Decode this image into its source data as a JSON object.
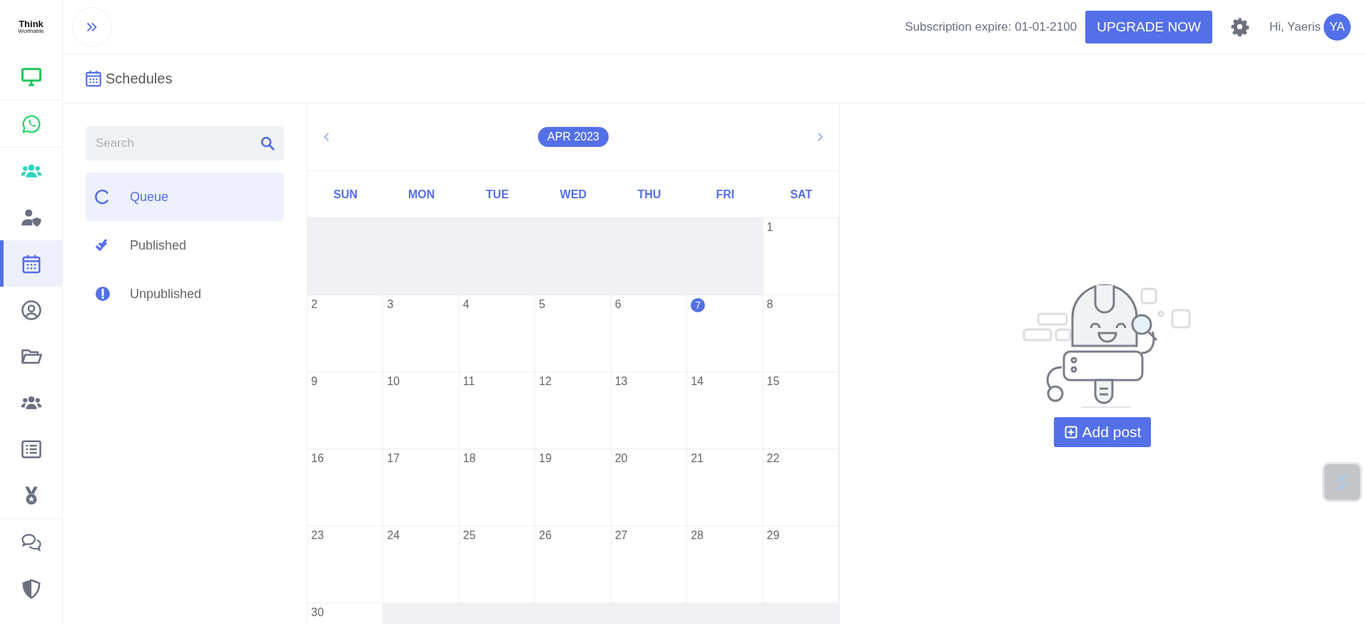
{
  "sidebar": {
    "logo": {
      "line_1": "Think",
      "line_2": "Worthable"
    },
    "groups": [
      [
        {
          "kind": "monitor",
          "selected": false,
          "color": "#22c55e"
        }
      ],
      [
        {
          "kind": "whatsapp",
          "selected": false,
          "color": "#25d366"
        }
      ],
      [
        {
          "kind": "users",
          "selected": false,
          "color": "#2dd4bf"
        },
        {
          "kind": "user-shield",
          "selected": false,
          "color": "#6b6f80"
        },
        {
          "kind": "calendar",
          "selected": true,
          "color": "#5470e8"
        },
        {
          "kind": "user-circle",
          "selected": false,
          "color": "#6b6f80"
        },
        {
          "kind": "folder",
          "selected": false,
          "color": "#6b6f80"
        },
        {
          "kind": "users",
          "selected": false,
          "color": "#6b6f80"
        },
        {
          "kind": "list",
          "selected": false,
          "color": "#6b6f80"
        },
        {
          "kind": "medal",
          "selected": false,
          "color": "#6b6f80"
        }
      ],
      [
        {
          "kind": "chat",
          "selected": false,
          "color": "#6b6f80"
        },
        {
          "kind": "shield",
          "selected": false,
          "color": "#6b6f80"
        }
      ]
    ]
  },
  "topbar": {
    "subscription": "Subscription expire: 01-01-2100",
    "upgrade_button": "UPGRADE NOW",
    "greeting": "Hi, Yaeris",
    "avatar": "YA"
  },
  "page_title": "Schedules",
  "filters": {
    "search": {
      "placeholder": "Search"
    },
    "items": [
      {
        "kind": "queue",
        "label": "Queue",
        "selected": true
      },
      {
        "kind": "published",
        "label": "Published",
        "selected": false
      },
      {
        "kind": "unpublished",
        "label": "Unpublished",
        "selected": false
      }
    ]
  },
  "calendar": {
    "month": "APR 2023",
    "weekdays": [
      "SUN",
      "MON",
      "TUE",
      "WED",
      "THU",
      "FRI",
      "SAT"
    ],
    "weeks": [
      [
        {
          "kind": "blank"
        },
        {
          "kind": "blank"
        },
        {
          "kind": "blank"
        },
        {
          "kind": "blank"
        },
        {
          "kind": "blank"
        },
        {
          "kind": "blank"
        },
        {
          "kind": "day",
          "day": "1",
          "today": false
        }
      ],
      [
        {
          "kind": "day",
          "day": "2",
          "today": false
        },
        {
          "kind": "day",
          "day": "3",
          "today": false
        },
        {
          "kind": "day",
          "day": "4",
          "today": false
        },
        {
          "kind": "day",
          "day": "5",
          "today": false
        },
        {
          "kind": "day",
          "day": "6",
          "today": false
        },
        {
          "kind": "day",
          "day": "7",
          "today": true
        },
        {
          "kind": "day",
          "day": "8",
          "today": false
        }
      ],
      [
        {
          "kind": "day",
          "day": "9",
          "today": false
        },
        {
          "kind": "day",
          "day": "10",
          "today": false
        },
        {
          "kind": "day",
          "day": "11",
          "today": false
        },
        {
          "kind": "day",
          "day": "12",
          "today": false
        },
        {
          "kind": "day",
          "day": "13",
          "today": false
        },
        {
          "kind": "day",
          "day": "14",
          "today": false
        },
        {
          "kind": "day",
          "day": "15",
          "today": false
        }
      ],
      [
        {
          "kind": "day",
          "day": "16",
          "today": false
        },
        {
          "kind": "day",
          "day": "17",
          "today": false
        },
        {
          "kind": "day",
          "day": "18",
          "today": false
        },
        {
          "kind": "day",
          "day": "19",
          "today": false
        },
        {
          "kind": "day",
          "day": "20",
          "today": false
        },
        {
          "kind": "day",
          "day": "21",
          "today": false
        },
        {
          "kind": "day",
          "day": "22",
          "today": false
        }
      ],
      [
        {
          "kind": "day",
          "day": "23",
          "today": false
        },
        {
          "kind": "day",
          "day": "24",
          "today": false
        },
        {
          "kind": "day",
          "day": "25",
          "today": false
        },
        {
          "kind": "day",
          "day": "26",
          "today": false
        },
        {
          "kind": "day",
          "day": "27",
          "today": false
        },
        {
          "kind": "day",
          "day": "28",
          "today": false
        },
        {
          "kind": "day",
          "day": "29",
          "today": false
        }
      ],
      [
        {
          "kind": "day",
          "day": "30",
          "today": false
        },
        {
          "kind": "blank"
        },
        {
          "kind": "blank"
        },
        {
          "kind": "blank"
        },
        {
          "kind": "blank"
        },
        {
          "kind": "blank"
        },
        {
          "kind": "blank"
        }
      ]
    ]
  },
  "empty_state": {
    "button": "Add post"
  }
}
